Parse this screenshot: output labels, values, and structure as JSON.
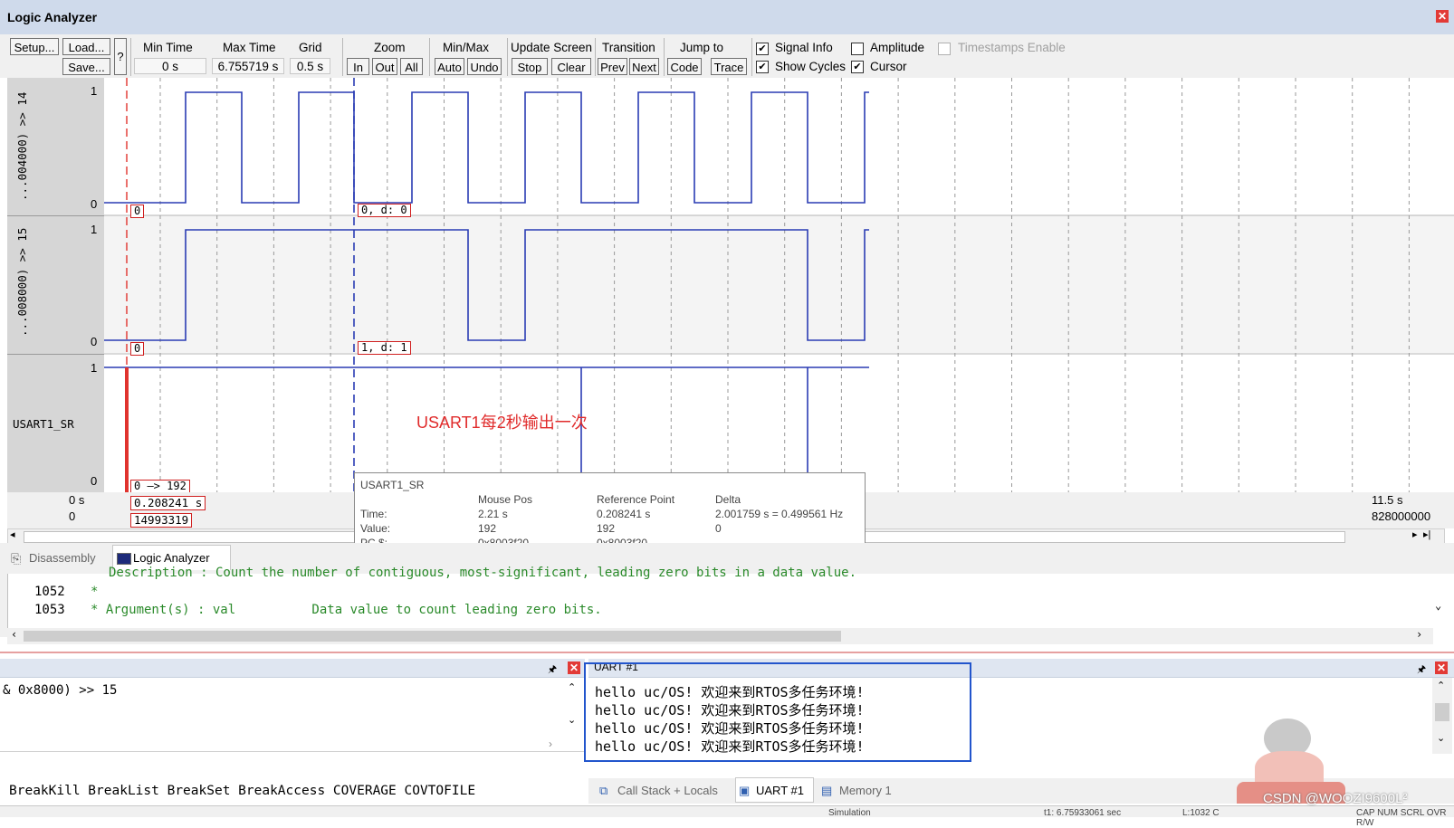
{
  "window": {
    "title": "Logic Analyzer"
  },
  "toolbar": {
    "setup": "Setup...",
    "load": "Load...",
    "save": "Save...",
    "help": "?",
    "min_time_label": "Min Time",
    "min_time_value": "0 s",
    "max_time_label": "Max Time",
    "max_time_value": "6.755719 s",
    "grid_label": "Grid",
    "grid_value": "0.5 s",
    "zoom_label": "Zoom",
    "zoom_in": "In",
    "zoom_out": "Out",
    "zoom_all": "All",
    "minmax_label": "Min/Max",
    "auto": "Auto",
    "undo": "Undo",
    "update_label": "Update Screen",
    "stop": "Stop",
    "clear": "Clear",
    "transition_label": "Transition",
    "prev": "Prev",
    "next": "Next",
    "jump_label": "Jump to",
    "code": "Code",
    "trace": "Trace",
    "signal_info": "Signal Info",
    "show_cycles": "Show Cycles",
    "amplitude": "Amplitude",
    "cursor": "Cursor",
    "timestamps": "Timestamps Enable"
  },
  "signals": [
    {
      "name": "...004000) >> 14",
      "max": "1",
      "min": "0",
      "left_value": "0",
      "cursor_value": "0,   d: 0"
    },
    {
      "name": "...008000) >> 15",
      "max": "1",
      "min": "0",
      "left_value": "0",
      "cursor_value": "1,   d: 1"
    },
    {
      "name": "USART1_SR",
      "max": "1",
      "min": "0",
      "left_value": "0 —> 192"
    }
  ],
  "axis": {
    "left_time": "0 s",
    "left_cycles": "0",
    "right_time": "11.5 s",
    "right_cycles": "828000000",
    "cursor_time": "0.208241  s",
    "cursor_cycles": "14993319"
  },
  "annotation": "USART1每2秒输出一次",
  "tooltip": {
    "signal": "USART1_SR",
    "col_mouse": "Mouse Pos",
    "col_ref": "Reference Point",
    "col_delta": "Delta",
    "row_time": "Time:",
    "row_value": "Value:",
    "row_pc": "PC $:",
    "mouse_time": "2.21 s",
    "mouse_value": "192",
    "mouse_pc": "0x8003f20",
    "ref_time": "0.208241 s",
    "ref_value": "192",
    "ref_pc": "0x8003f20",
    "delta_time": "2.001759 s = 0.499561 Hz",
    "delta_value": "0"
  },
  "tabs": {
    "disassembly": "Disassembly",
    "logic": "Logic Analyzer"
  },
  "code": {
    "line_top": "Description : Count the number of contiguous, most-significant, leading zero bits in a data value.",
    "line_1052_no": "1052",
    "line_1052": "*",
    "line_1053_no": "1053",
    "line_1053": "* Argument(s) : val          Data value to count leading zero bits."
  },
  "command": {
    "text": "& 0x8000) >> 15",
    "help": "BreakKill BreakList BreakSet BreakAccess COVERAGE COVTOFILE"
  },
  "uart": {
    "title": "UART #1",
    "lines": [
      "hello uc/OS! 欢迎来到RTOS多任务环境!",
      "hello uc/OS! 欢迎来到RTOS多任务环境!",
      "hello uc/OS! 欢迎来到RTOS多任务环境!",
      "hello uc/OS! 欢迎来到RTOS多任务环境!"
    ]
  },
  "bottom_tabs": {
    "callstack": "Call Stack + Locals",
    "uart": "UART #1",
    "memory": "Memory 1"
  },
  "watermark": "CSDN @WOOZI9600L²",
  "status": {
    "simulation": "Simulation",
    "time": "t1: 6.75933061 sec",
    "line": "L:1032 C",
    "caps": "CAP NUM SCRL OVR R/W"
  },
  "colors": {
    "wave": "#2a3cb4",
    "cursor_red": "#e0332e",
    "annotation": "#e02b2b",
    "highlight_box": "#2255cc"
  }
}
